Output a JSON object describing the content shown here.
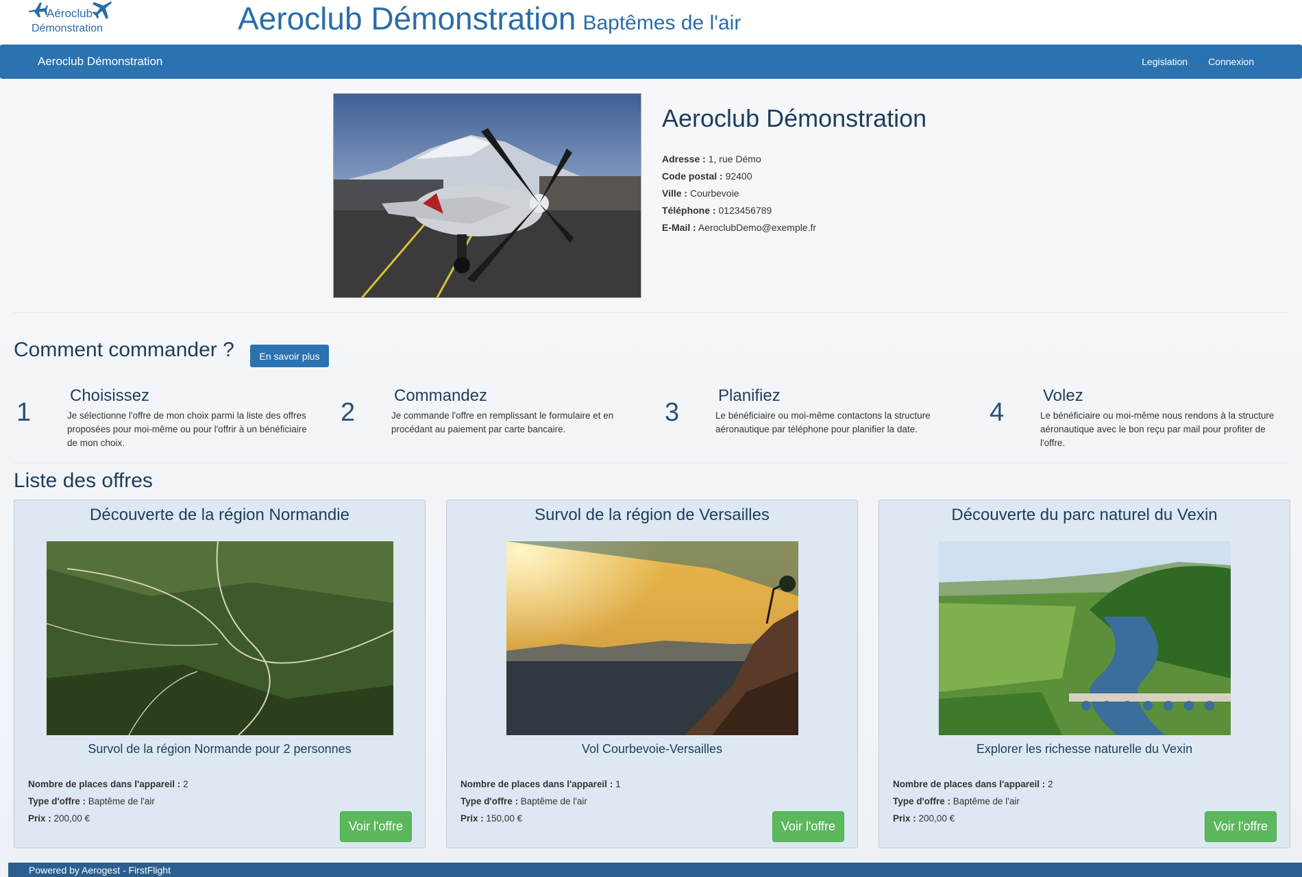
{
  "header": {
    "logo_line1": "Aéroclub",
    "logo_line2": "Démonstration",
    "title": "Aeroclub Démonstration",
    "subtitle": "Baptêmes de l'air"
  },
  "navbar": {
    "brand": "Aeroclub Démonstration",
    "links": [
      "Legislation",
      "Connexion"
    ]
  },
  "club": {
    "name": "Aeroclub Démonstration",
    "fields": [
      {
        "label": "Adresse :",
        "value": "1, rue Démo"
      },
      {
        "label": "Code postal :",
        "value": "92400"
      },
      {
        "label": "Ville :",
        "value": "Courbevoie"
      },
      {
        "label": "Téléphone :",
        "value": "0123456789"
      },
      {
        "label": "E-Mail :",
        "value": "AeroclubDemo@exemple.fr"
      }
    ]
  },
  "how": {
    "title": "Comment commander ?",
    "more_button": "En savoir plus",
    "steps": [
      {
        "num": "1",
        "title": "Choisissez",
        "desc": "Je sélectionne l'offre de mon choix parmi la liste des offres proposées pour moi-même ou pour l'offrir à un bénéficiaire de mon choix."
      },
      {
        "num": "2",
        "title": "Commandez",
        "desc": "Je commande l'offre en remplissant le formulaire et en procédant au paiement par carte bancaire."
      },
      {
        "num": "3",
        "title": "Planifiez",
        "desc": "Le bénéficiaire ou moi-même contactons la structure aéronautique par téléphone pour planifier la date."
      },
      {
        "num": "4",
        "title": "Volez",
        "desc": "Le bénéficiaire ou moi-même nous rendons à la structure aéronautique avec le bon reçu par mail pour profiter de l'offre."
      }
    ]
  },
  "offers": {
    "title": "Liste des offres",
    "labels": {
      "seats": "Nombre de places dans l'appareil :",
      "type": "Type d'offre :",
      "price": "Prix :"
    },
    "button_label": "Voir l'offre",
    "items": [
      {
        "title": "Découverte de la région Normandie",
        "desc": "Survol de la région Normande pour 2 personnes",
        "seats": "2",
        "type": "Baptême de l'air",
        "price": "200,00 €"
      },
      {
        "title": "Survol de la région de Versailles",
        "desc": "Vol Courbevoie-Versailles",
        "seats": "1",
        "type": "Baptême de l'air",
        "price": "150,00 €"
      },
      {
        "title": "Découverte du parc naturel du Vexin",
        "desc": "Explorer les richesse naturelle du Vexin",
        "seats": "2",
        "type": "Baptême de l'air",
        "price": "200,00 €"
      }
    ]
  },
  "footer": {
    "text": "Powered by Aerogest - FirstFlight"
  }
}
